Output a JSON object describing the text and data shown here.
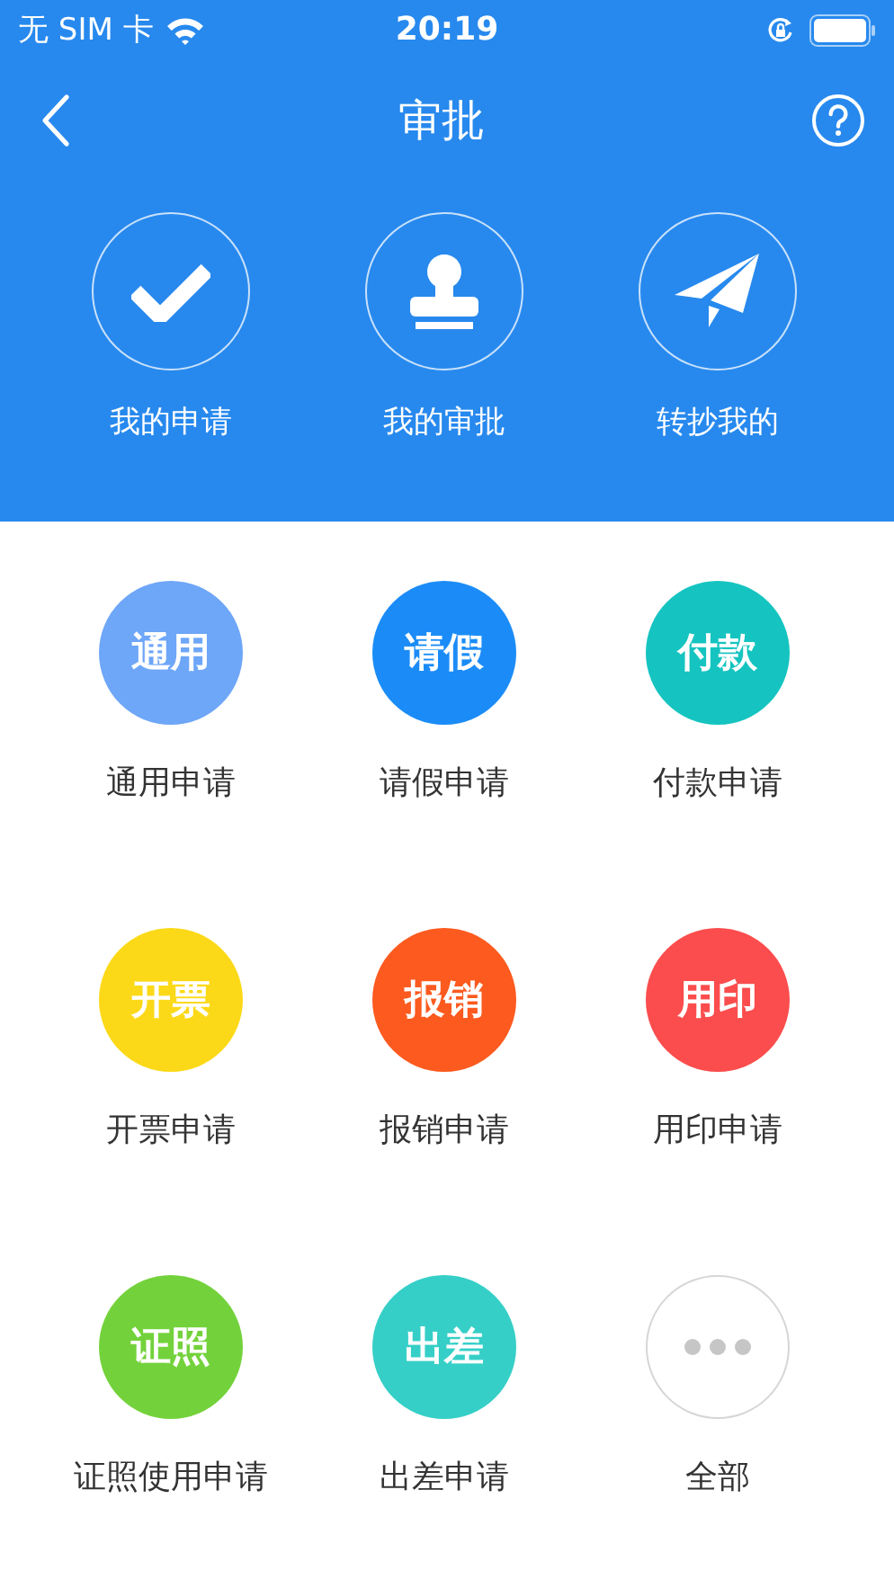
{
  "status_bar": {
    "carrier": "无 SIM 卡",
    "time": "20:19"
  },
  "nav": {
    "title": "审批"
  },
  "actions": [
    {
      "kind": "check",
      "label": "我的申请"
    },
    {
      "kind": "stamp",
      "label": "我的审批"
    },
    {
      "kind": "plane",
      "label": "转抄我的"
    }
  ],
  "apply_types": [
    {
      "kind": "badge",
      "badge": "通用",
      "label": "通用申请",
      "color": "#6ea6f8"
    },
    {
      "kind": "badge",
      "badge": "请假",
      "label": "请假申请",
      "color": "#1b8cf7"
    },
    {
      "kind": "badge",
      "badge": "付款",
      "label": "付款申请",
      "color": "#15c4c0"
    },
    {
      "kind": "badge",
      "badge": "开票",
      "label": "开票申请",
      "color": "#fcd918"
    },
    {
      "kind": "badge",
      "badge": "报销",
      "label": "报销申请",
      "color": "#fc5a1f"
    },
    {
      "kind": "badge",
      "badge": "用印",
      "label": "用印申请",
      "color": "#fb4d4d"
    },
    {
      "kind": "badge",
      "badge": "证照",
      "label": "证照使用申请",
      "color": "#73d23b"
    },
    {
      "kind": "badge",
      "badge": "出差",
      "label": "出差申请",
      "color": "#35cfc7"
    },
    {
      "kind": "more",
      "label": "全部"
    }
  ]
}
